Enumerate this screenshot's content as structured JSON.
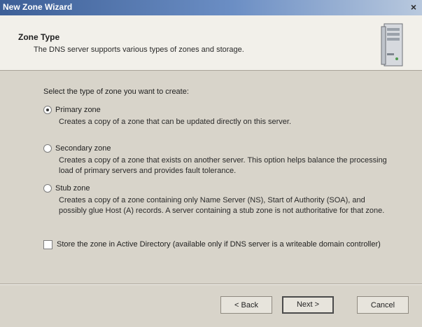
{
  "window": {
    "title": "New Zone Wizard",
    "close_symbol": "×"
  },
  "header": {
    "title": "Zone Type",
    "subtitle": "The DNS server supports various types of zones and storage.",
    "icon": "server-icon"
  },
  "prompt": "Select the type of zone you want to create:",
  "options": [
    {
      "label": "Primary zone",
      "checked": true,
      "desc": "Creates a copy of a zone that can be updated directly on this server."
    },
    {
      "label": "Secondary zone",
      "checked": false,
      "desc": "Creates a copy of a zone that exists on another server. This option helps balance the processing load of primary servers and provides fault tolerance."
    },
    {
      "label": "Stub zone",
      "checked": false,
      "desc": "Creates a copy of a zone containing only Name Server (NS), Start of Authority (SOA), and possibly glue Host (A) records. A server containing a stub zone is not authoritative for that zone."
    }
  ],
  "store_in_ad": {
    "label": "Store the zone in Active Directory (available only if DNS server is a writeable domain controller)",
    "checked": false
  },
  "buttons": {
    "back": "< Back",
    "next": "Next >",
    "cancel": "Cancel"
  }
}
